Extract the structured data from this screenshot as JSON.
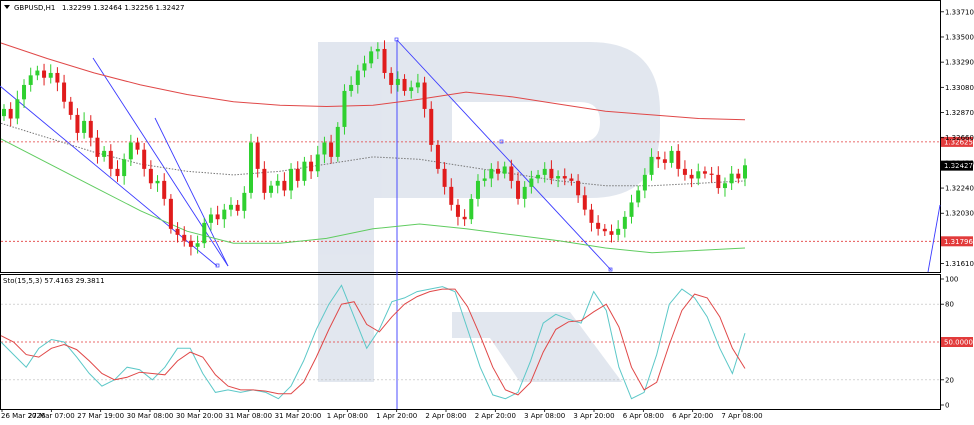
{
  "chart_data": {
    "type": "candlestick",
    "symbol_header": "GBPUSD,H1",
    "ohlc_header": "1.32299 1.32464 1.32256 1.32427",
    "price_axis": {
      "ticks": [
        "1.33710",
        "1.33500",
        "1.33290",
        "1.33080",
        "1.32870",
        "1.32660",
        "1.32450",
        "1.32240",
        "1.32030",
        "1.31610"
      ],
      "ylim": [
        1.3154,
        1.338
      ]
    },
    "levels": {
      "resistance": {
        "value": 1.32625,
        "label": "1.32625",
        "color": "#e23b3b"
      },
      "current": {
        "value": 1.32427,
        "label": "1.32427",
        "color": "#000000"
      },
      "support": {
        "value": 1.31796,
        "label": "1.31796",
        "color": "#e23b3b"
      }
    },
    "time_axis": {
      "labels": [
        "26 Mar 2026",
        "27 Mar 07:00",
        "27 Mar 19:00",
        "30 Mar 08:00",
        "30 Mar 20:00",
        "31 Mar 08:00",
        "31 Mar 20:00",
        "1 Apr 08:00",
        "1 Apr 20:00",
        "2 Apr 08:00",
        "2 Apr 20:00",
        "3 Apr 08:00",
        "3 Apr 20:00",
        "6 Apr 08:00",
        "6 Apr 20:00",
        "7 Apr 08:00"
      ]
    },
    "close_series": [
      1.329,
      1.3282,
      1.3298,
      1.331,
      1.3318,
      1.3322,
      1.3316,
      1.332,
      1.3312,
      1.3296,
      1.3285,
      1.327,
      1.328,
      1.3266,
      1.325,
      1.3255,
      1.324,
      1.3234,
      1.3248,
      1.3262,
      1.3256,
      1.324,
      1.3228,
      1.323,
      1.3215,
      1.319,
      1.3185,
      1.318,
      1.3175,
      1.3178,
      1.3195,
      1.3202,
      1.3198,
      1.3206,
      1.321,
      1.3205,
      1.322,
      1.3262,
      1.324,
      1.322,
      1.3226,
      1.323,
      1.3222,
      1.324,
      1.323,
      1.3246,
      1.3238,
      1.3252,
      1.3262,
      1.325,
      1.3275,
      1.3305,
      1.331,
      1.3322,
      1.3328,
      1.3338,
      1.334,
      1.332,
      1.331,
      1.3315,
      1.3305,
      1.3308,
      1.3312,
      1.329,
      1.326,
      1.324,
      1.3225,
      1.321,
      1.32,
      1.3198,
      1.3215,
      1.323,
      1.3232,
      1.324,
      1.3236,
      1.3242,
      1.323,
      1.3215,
      1.3225,
      1.3232,
      1.3235,
      1.324,
      1.3232,
      1.3234,
      1.3232,
      1.323,
      1.3218,
      1.3206,
      1.3195,
      1.319,
      1.3188,
      1.3185,
      1.319,
      1.32,
      1.3212,
      1.3222,
      1.3235,
      1.325,
      1.3248,
      1.3245,
      1.3255,
      1.324,
      1.3235,
      1.3232,
      1.3238,
      1.3236,
      1.3235,
      1.3224,
      1.3228,
      1.3236,
      1.3232,
      1.3243
    ],
    "moving_averages": [
      {
        "color": "#e04848",
        "values": [
          1.3345,
          1.3332,
          1.332,
          1.331,
          1.3302,
          1.3296,
          1.3293,
          1.3292,
          1.3293,
          1.3298,
          1.3304,
          1.33,
          1.3294,
          1.3288,
          1.3285,
          1.3282,
          1.3281
        ]
      },
      {
        "color": "#60cc60",
        "values": [
          1.3265,
          1.3245,
          1.3225,
          1.3205,
          1.3188,
          1.3178,
          1.3178,
          1.3182,
          1.319,
          1.3194,
          1.319,
          1.3185,
          1.318,
          1.3174,
          1.317,
          1.3172,
          1.3174
        ]
      },
      {
        "color": "#777777",
        "values": [
          1.3278,
          1.3266,
          1.3254,
          1.3244,
          1.3238,
          1.3235,
          1.3238,
          1.3244,
          1.325,
          1.3248,
          1.3242,
          1.3236,
          1.323,
          1.3226,
          1.3226,
          1.3228,
          1.323
        ]
      }
    ],
    "stochastic": {
      "header": "Sto(15,5,3) 57.4163 29.3811",
      "ylim": [
        0,
        100
      ],
      "ticks": [
        "100",
        "80",
        "20",
        "0"
      ],
      "midline": {
        "value": 50,
        "label": "50.0000",
        "color": "#e23b3b"
      },
      "main_color": "#5cc8c8",
      "signal_color": "#e04848",
      "main_values": [
        50,
        40,
        30,
        45,
        52,
        50,
        38,
        25,
        15,
        20,
        30,
        28,
        20,
        30,
        45,
        45,
        25,
        10,
        12,
        10,
        12,
        10,
        5,
        15,
        35,
        60,
        80,
        95,
        70,
        45,
        60,
        82,
        85,
        90,
        92,
        94,
        90,
        60,
        30,
        8,
        5,
        10,
        35,
        65,
        72,
        68,
        65,
        90,
        75,
        30,
        5,
        10,
        40,
        80,
        92,
        85,
        70,
        45,
        25,
        57
      ],
      "signal_values": [
        55,
        50,
        40,
        38,
        45,
        48,
        44,
        35,
        25,
        20,
        22,
        26,
        25,
        24,
        35,
        42,
        38,
        24,
        15,
        12,
        12,
        11,
        9,
        9,
        18,
        38,
        60,
        80,
        82,
        64,
        58,
        70,
        80,
        86,
        90,
        92,
        92,
        78,
        55,
        30,
        12,
        8,
        18,
        42,
        60,
        66,
        67,
        74,
        80,
        62,
        30,
        12,
        18,
        48,
        75,
        88,
        85,
        70,
        45,
        29
      ]
    }
  }
}
